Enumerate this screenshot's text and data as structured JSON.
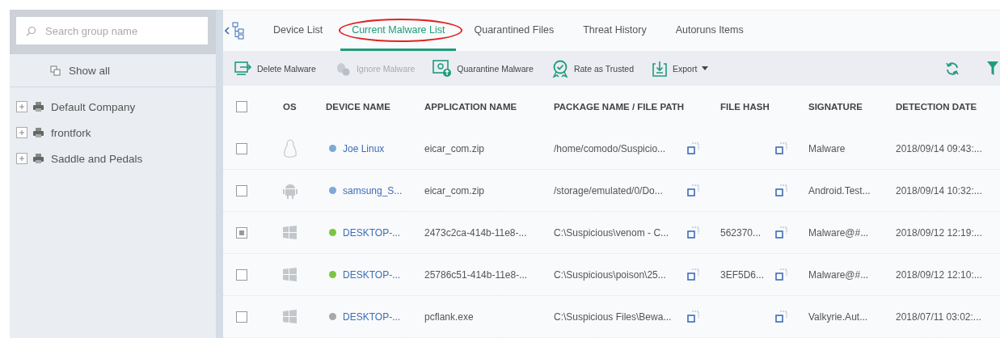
{
  "sidebar": {
    "search": {
      "placeholder": "Search group name"
    },
    "show_all": "Show all",
    "groups": [
      {
        "label": "Default Company",
        "expanded": false
      },
      {
        "label": "frontfork",
        "expanded": false
      },
      {
        "label": "Saddle and Pedals",
        "expanded": false
      }
    ]
  },
  "tabs": [
    {
      "label": "Device List",
      "selected": false,
      "circled": false
    },
    {
      "label": "Current Malware List",
      "selected": true,
      "circled": true
    },
    {
      "label": "Quarantined Files",
      "selected": false,
      "circled": false
    },
    {
      "label": "Threat History",
      "selected": false,
      "circled": false
    },
    {
      "label": "Autoruns Items",
      "selected": false,
      "circled": false
    }
  ],
  "toolbar": [
    {
      "kind": "delete",
      "label": "Delete Malware",
      "disabled": false
    },
    {
      "kind": "ignore",
      "label": "Ignore Malware",
      "disabled": true
    },
    {
      "kind": "quarantine",
      "label": "Quarantine Malware",
      "disabled": false
    },
    {
      "kind": "trusted",
      "label": "Rate as Trusted",
      "disabled": false
    },
    {
      "kind": "export",
      "label": "Export",
      "disabled": false
    }
  ],
  "table": {
    "select_all_checked": false,
    "columns": [
      "OS",
      "DEVICE NAME",
      "APPLICATION NAME",
      "PACKAGE NAME / FILE PATH",
      "FILE HASH",
      "SIGNATURE",
      "DETECTION DATE"
    ],
    "rows": [
      {
        "checked": false,
        "kind": "linux",
        "color": "#7fa8d8",
        "device": "Joe Linux",
        "application": "eicar_com.zip",
        "path": "/home/comodo/Suspicio...",
        "hash": "",
        "signature": "Malware",
        "date": "2018/09/14 09:43:..."
      },
      {
        "checked": false,
        "kind": "android",
        "color": "#7fa8d8",
        "device": "samsung_S...",
        "application": "eicar_com.zip",
        "path": "/storage/emulated/0/Do...",
        "hash": "",
        "signature": "Android.Test...",
        "date": "2018/09/14 10:32:..."
      },
      {
        "checked": true,
        "kind": "windows",
        "color": "#7cc443",
        "device": "DESKTOP-...",
        "application": "2473c2ca-414b-11e8-...",
        "path": "C:\\Suspicious\\venom - C...",
        "hash": "562370...",
        "signature": "Malware@#...",
        "date": "2018/09/12 12:19:..."
      },
      {
        "checked": false,
        "kind": "windows",
        "color": "#7cc443",
        "device": "DESKTOP-...",
        "application": "25786c51-414b-11e8-...",
        "path": "C:\\Suspicious\\poison\\25...",
        "hash": "3EF5D6...",
        "signature": "Malware@#...",
        "date": "2018/09/12 12:10:..."
      },
      {
        "checked": false,
        "kind": "windows",
        "color": "#a8a8a8",
        "device": "DESKTOP-...",
        "application": "pcflank.exe",
        "path": "C:\\Suspicious Files\\Bewa...",
        "hash": "",
        "signature": "Valkyrie.Aut...",
        "date": "2018/07/11 03:02:..."
      }
    ]
  }
}
